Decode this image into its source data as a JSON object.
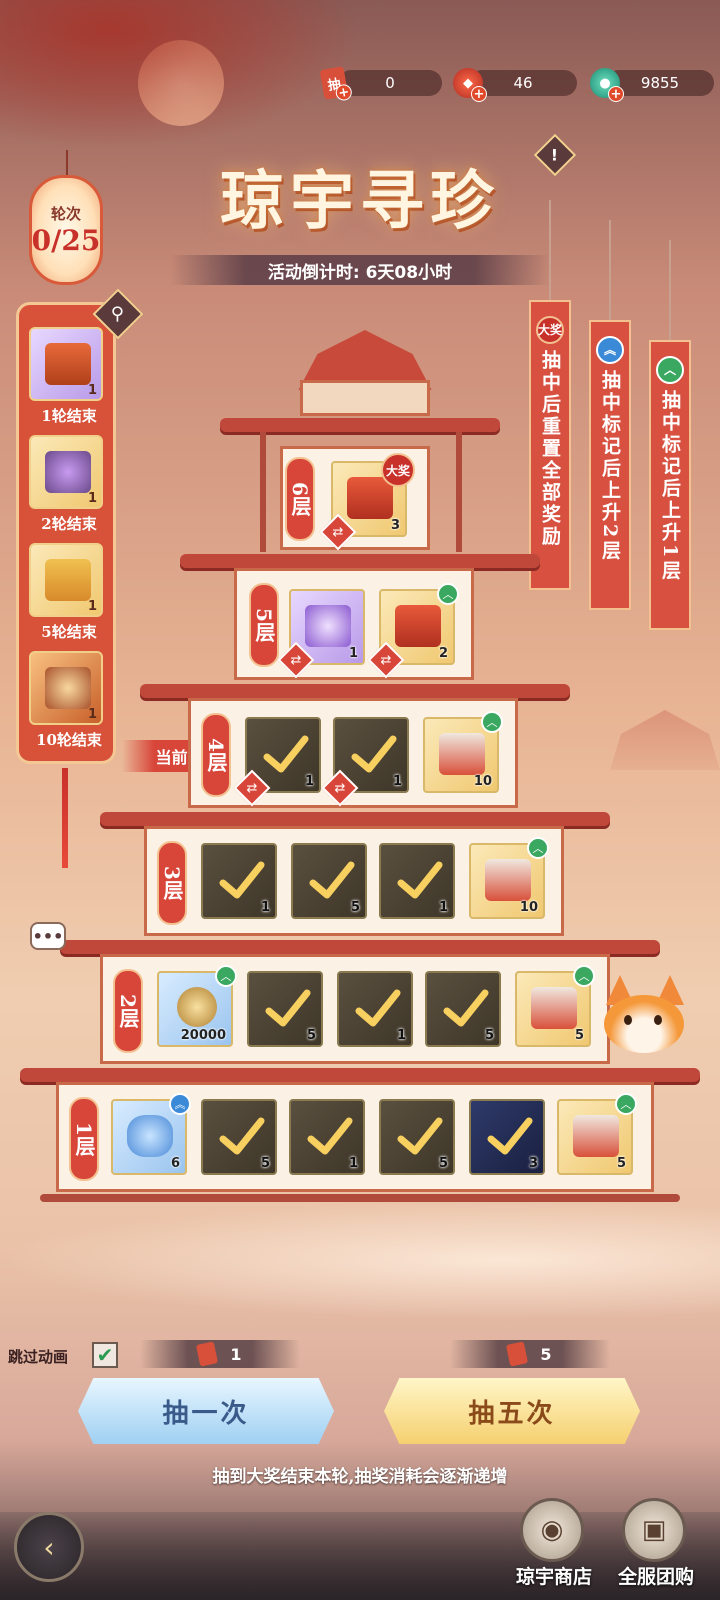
{
  "resources": [
    {
      "icon": "draw-ticket-icon",
      "value": "0"
    },
    {
      "icon": "red-gem-icon",
      "value": "46"
    },
    {
      "icon": "jade-coin-icon",
      "value": "9855"
    }
  ],
  "title": "琼宇寻珍",
  "countdown": "活动倒计时: 6天08小时",
  "round": {
    "label": "轮次",
    "value": "0/25"
  },
  "round_rewards": [
    {
      "label": "1轮结束",
      "qty": "1"
    },
    {
      "label": "2轮结束",
      "qty": "1"
    },
    {
      "label": "5轮结束",
      "qty": "1"
    },
    {
      "label": "10轮结束",
      "qty": "1"
    }
  ],
  "banners": [
    {
      "badge": "大奖",
      "text": "抽中后重置全部奖励"
    },
    {
      "badge": "up2",
      "text": "抽中标记后上升2层"
    },
    {
      "badge": "up1",
      "text": "抽中标记后上升1层"
    }
  ],
  "floors": {
    "f6": {
      "label": "6层",
      "items": [
        {
          "qty": "3"
        }
      ]
    },
    "f5": {
      "label": "5层",
      "items": [
        {
          "qty": "1"
        },
        {
          "qty": "2"
        }
      ]
    },
    "f4": {
      "label": "4层",
      "items": [
        {
          "qty": "1"
        },
        {
          "qty": "1"
        },
        {
          "qty": "10"
        }
      ]
    },
    "f3": {
      "label": "3层",
      "items": [
        {
          "qty": "1"
        },
        {
          "qty": "5"
        },
        {
          "qty": "1"
        },
        {
          "qty": "10"
        }
      ]
    },
    "f2": {
      "label": "2层",
      "items": [
        {
          "qty": "20000"
        },
        {
          "qty": "5"
        },
        {
          "qty": "1"
        },
        {
          "qty": "5"
        },
        {
          "qty": "5"
        }
      ]
    },
    "f1": {
      "label": "1层",
      "items": [
        {
          "qty": "6"
        },
        {
          "qty": "5"
        },
        {
          "qty": "1"
        },
        {
          "qty": "5"
        },
        {
          "qty": "3"
        },
        {
          "qty": "5"
        }
      ]
    }
  },
  "grand_prize_badge": "大奖",
  "current_label": "当前",
  "skip_animation": {
    "label": "跳过动画",
    "checked": true
  },
  "draw_one": {
    "label": "抽一次",
    "cost": "1"
  },
  "draw_five": {
    "label": "抽五次",
    "cost": "5"
  },
  "hint": "抽到大奖结束本轮,抽奖消耗会逐渐递增",
  "nav": {
    "shop": "琼宇商店",
    "group_buy": "全服团购"
  }
}
